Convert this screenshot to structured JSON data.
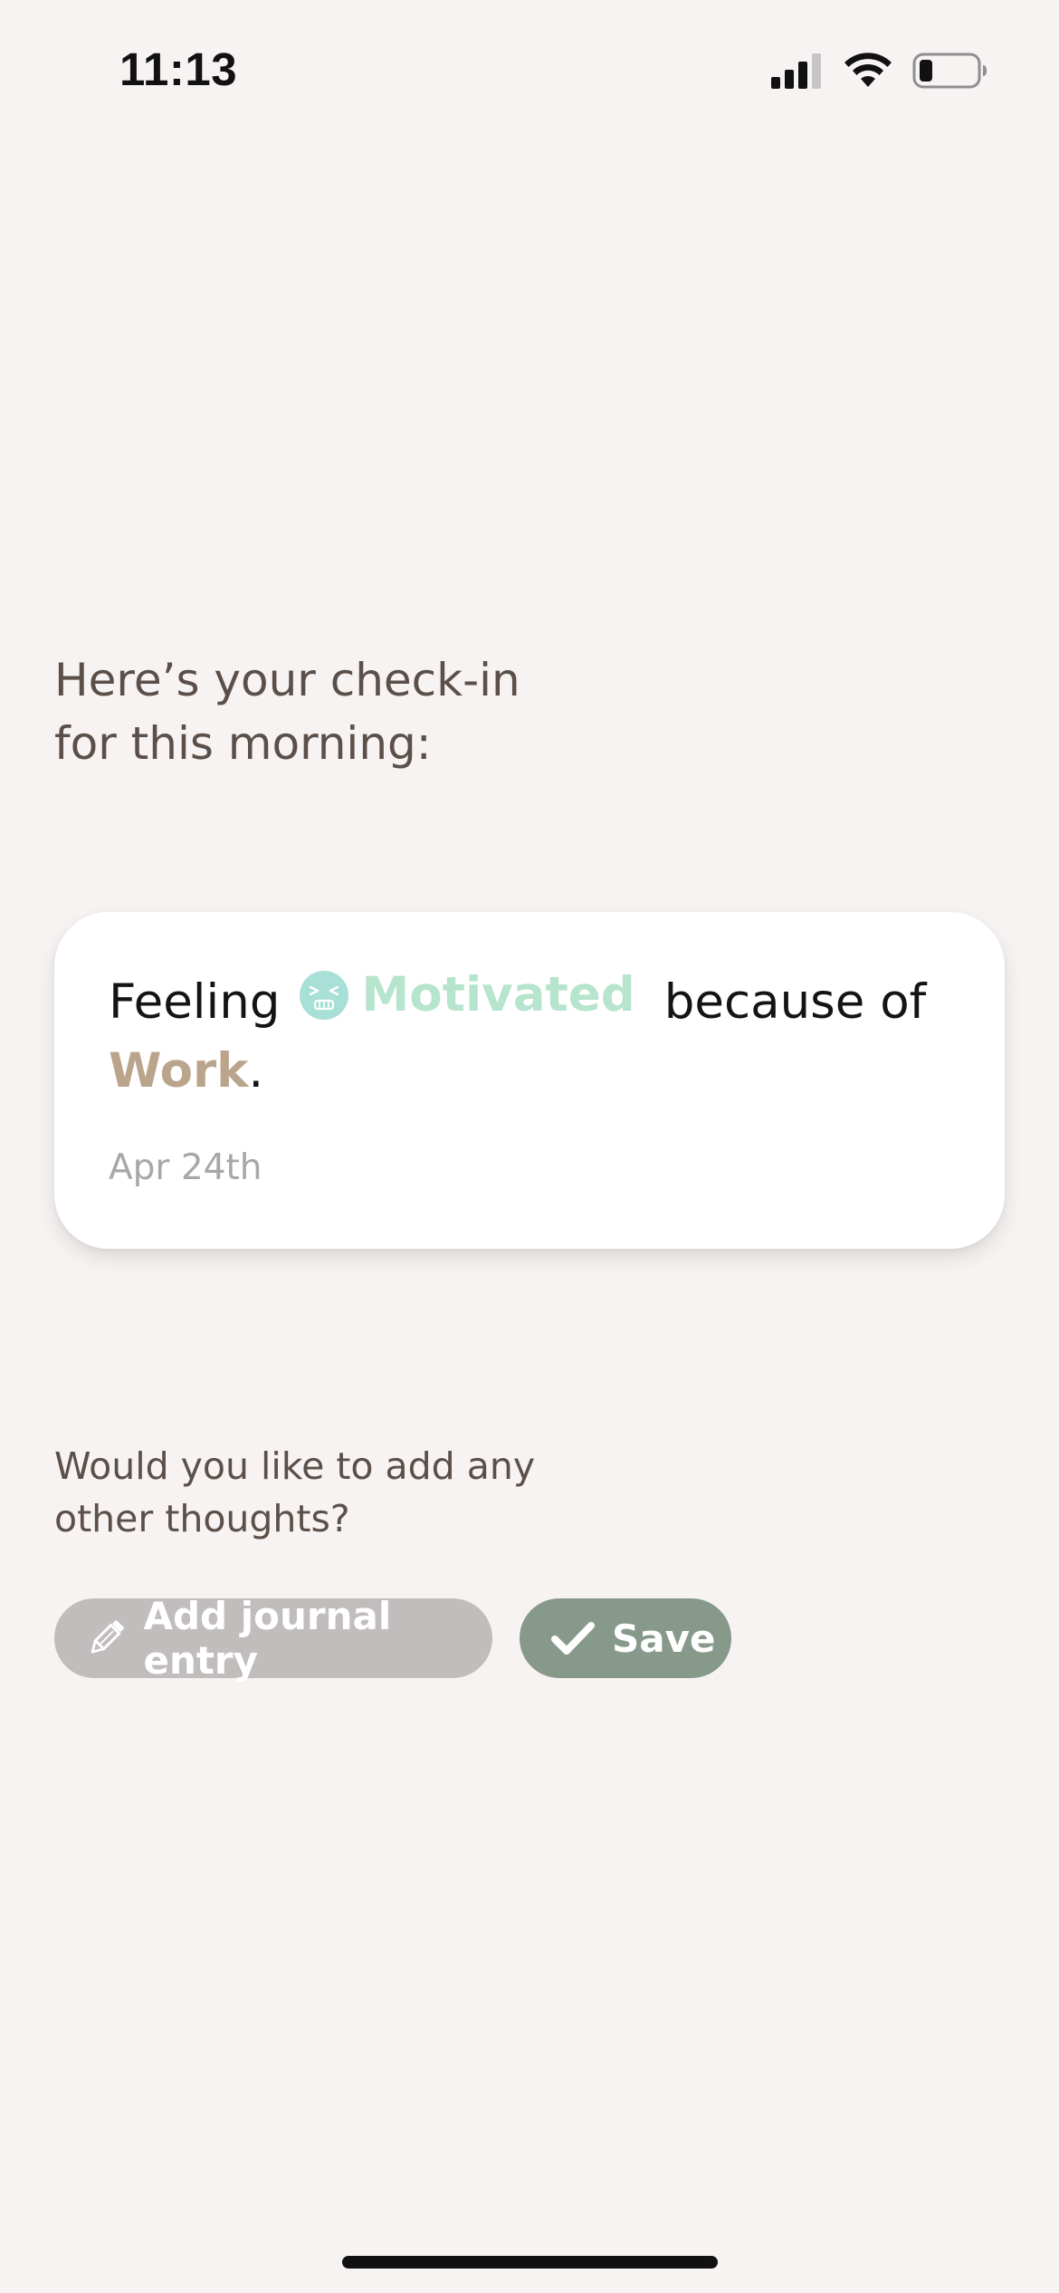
{
  "status_bar": {
    "time": "11:13",
    "icons": [
      "cellular-signal-icon",
      "wifi-icon",
      "battery-icon"
    ]
  },
  "heading": {
    "line1": "Here’s your check-in",
    "line2": "for this morning:"
  },
  "checkin_card": {
    "feeling_prefix": "Feeling",
    "emotion_icon": "grimacing-face-icon",
    "emotion_label": "Motivated",
    "because_text": "because of",
    "cause_label": "Work",
    "cause_suffix": ".",
    "date": "Apr 24th"
  },
  "prompt": {
    "line1": "Would you like to add any",
    "line2": "other thoughts?"
  },
  "actions": {
    "journal_icon": "pencil-icon",
    "journal_label": "Add journal entry",
    "save_icon": "checkmark-icon",
    "save_label": "Save"
  },
  "colors": {
    "background": "#f7f3f2",
    "heading_text": "#5b4f49",
    "emotion": "#b6e4cd",
    "emotion_icon": "#a8dfd6",
    "cause": "#baa58c",
    "date_text": "#a7a7a7",
    "journal_button": "#c1bdbc",
    "save_button": "#86998b"
  }
}
